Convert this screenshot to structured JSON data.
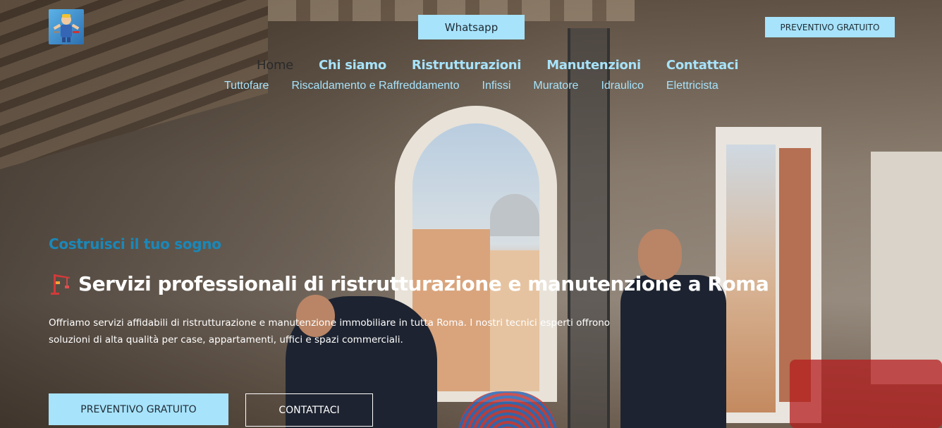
{
  "header": {
    "logo_icon": "handyman-logo-icon",
    "whatsapp_label": "Whatsapp",
    "quote_label": "PREVENTIVO GRATUITO"
  },
  "nav": {
    "main": [
      {
        "label": "Home",
        "active": true
      },
      {
        "label": "Chi siamo"
      },
      {
        "label": "Ristrutturazioni"
      },
      {
        "label": "Manutenzioni"
      },
      {
        "label": "Contattaci"
      }
    ],
    "sub": [
      {
        "label": "Tuttofare"
      },
      {
        "label": "Riscaldamento e Raffreddamento"
      },
      {
        "label": "Infissi"
      },
      {
        "label": "Muratore"
      },
      {
        "label": "Idraulico"
      },
      {
        "label": "Elettricista"
      }
    ]
  },
  "hero": {
    "tagline": "Costruisci il tuo sogno",
    "headline_icon": "crane-icon",
    "headline": "Servizi professionali di ristrutturazione e manutenzione a Roma",
    "description": "Offriamo servizi affidabili di ristrutturazione e manutenzione immobiliare in tutta Roma. I nostri tecnici esperti offrono soluzioni di alta qualità per case, appartamenti, uffici e spazi commerciali.",
    "primary_button": "PREVENTIVO GRATUITO",
    "secondary_button": "CONTATTACI"
  },
  "colors": {
    "accent": "#a7e3fb",
    "tagline": "#1a88b9",
    "headline": "#ffffff"
  }
}
